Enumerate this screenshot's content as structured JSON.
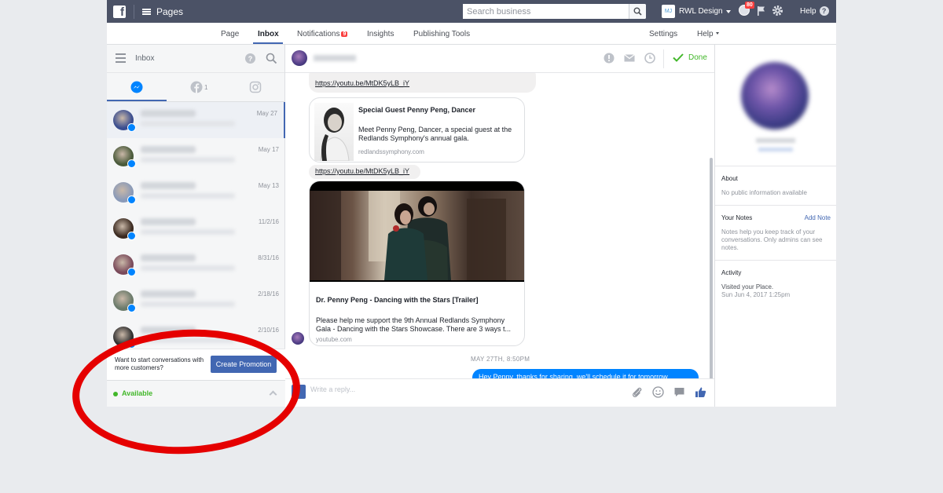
{
  "topbar": {
    "logo": "f",
    "pages_label": "Pages",
    "search_placeholder": "Search business",
    "account_initials": "MJ",
    "account_name": "RWL Design",
    "notif_count": "80",
    "help_label": "Help",
    "help_glyph": "?"
  },
  "nav": {
    "page": "Page",
    "inbox": "Inbox",
    "notifications": "Notifications",
    "notifications_count": "9",
    "insights": "Insights",
    "publishing_tools": "Publishing Tools",
    "settings": "Settings",
    "help": "Help"
  },
  "left": {
    "title": "Inbox",
    "help_glyph": "?",
    "facebook_count": "1",
    "conversations": [
      {
        "date": "May 27",
        "avatar_color": "#3a4d8f"
      },
      {
        "date": "May 17",
        "avatar_color": "#4a5a3a"
      },
      {
        "date": "May 13",
        "avatar_color": "#8a9ab8"
      },
      {
        "date": "11/2/16",
        "avatar_color": "#3b2a20"
      },
      {
        "date": "8/31/16",
        "avatar_color": "#7a4a5a"
      },
      {
        "date": "2/18/16",
        "avatar_color": "#6a7a6a"
      },
      {
        "date": "2/10/16",
        "avatar_color": "#2f2f2f"
      }
    ],
    "promo_text": "Want to start conversations with more customers?",
    "promo_button": "Create Promotion",
    "status": "Available"
  },
  "chat": {
    "done_label": "Done",
    "link1": "https://youtu.be/MtDK5yLB_iY",
    "card1": {
      "title": "Special Guest Penny Peng, Dancer",
      "description": "Meet Penny Peng, Dancer, a special guest at the Redlands Symphony's annual gala.",
      "source": "redlandssymphony.com"
    },
    "link2": "https://youtu.be/MtDK5yLB_iY",
    "card2": {
      "title": "Dr. Penny Peng - Dancing with the Stars [Trailer]",
      "description": "Please help me support the 9th Annual Redlands Symphony Gala - Dancing with the Stars Showcase. There are 3 ways t...",
      "source": "youtube.com"
    },
    "timestamp": "MAY 27TH, 8:50PM",
    "outgoing": "Hey Penny, thanks for sharing, we'll schedule it for tomorrow",
    "composer_placeholder": "Write a reply..."
  },
  "right": {
    "about_h": "About",
    "about_t": "No public information available",
    "notes_h": "Your Notes",
    "add_note": "Add Note",
    "notes_t": "Notes help you keep track of your conversations. Only admins can see notes.",
    "activity_h": "Activity",
    "activity_t1": "Visited your Place.",
    "activity_t2": "Sun Jun 4, 2017 1:25pm"
  },
  "colors": {
    "topbar": "#4b5266",
    "brand_blue": "#4267b2",
    "messenger_blue": "#0084ff",
    "green": "#42b72a",
    "annotation_red": "#e50000"
  }
}
